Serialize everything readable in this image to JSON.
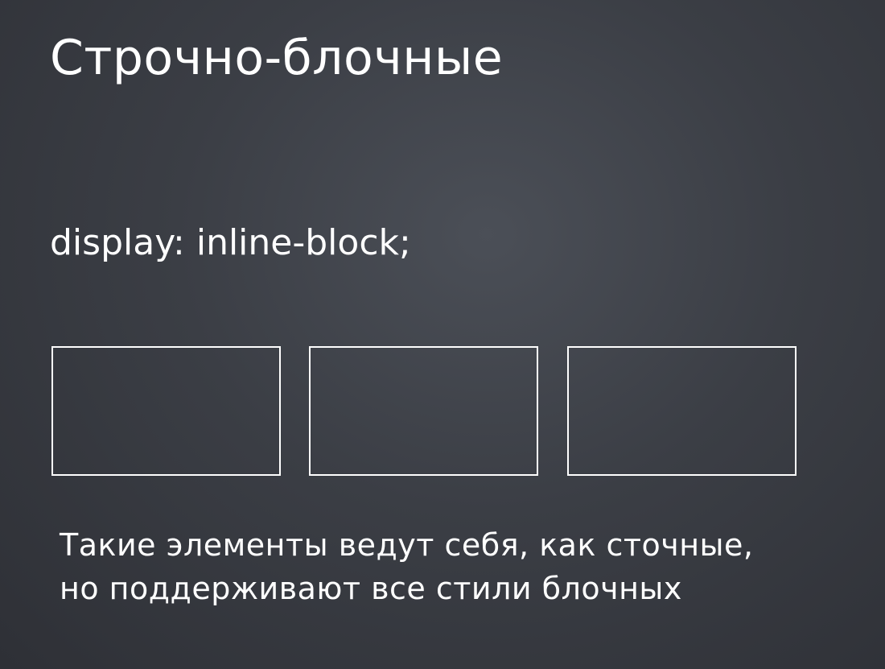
{
  "slide": {
    "title": "Строчно-блочные",
    "code": "display: inline-block;",
    "description_lines": [
      "Такие элементы ведут себя, как сточные,",
      "но поддерживают все стили блочных"
    ],
    "boxes_count": 3
  },
  "colors": {
    "background": "#3b3e45",
    "text": "#ffffff",
    "box_border": "#ffffff"
  }
}
